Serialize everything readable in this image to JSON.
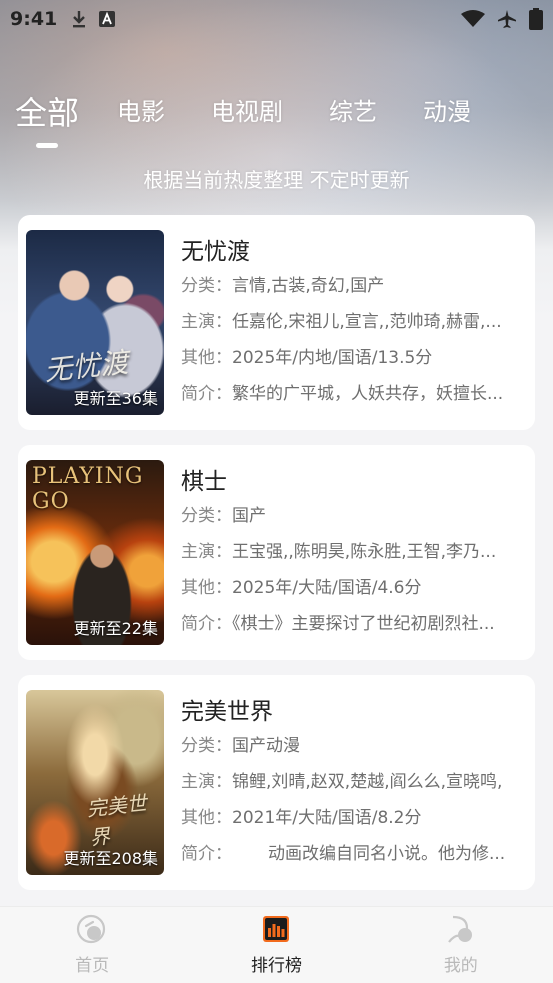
{
  "status_bar": {
    "time": "9:41",
    "icons": [
      "download-icon",
      "app-a-icon",
      "wifi-icon",
      "airplane-icon",
      "battery-icon"
    ]
  },
  "tabs": [
    {
      "label": "全部",
      "active": true
    },
    {
      "label": "电影",
      "active": false
    },
    {
      "label": "电视剧",
      "active": false
    },
    {
      "label": "综艺",
      "active": false
    },
    {
      "label": "动漫",
      "active": false
    }
  ],
  "subtitle": "根据当前热度整理 不定时更新",
  "cards": [
    {
      "title": "无忧渡",
      "badge": "更新至36集",
      "category_label": "分类：",
      "category": "言情,古装,奇幻,国产",
      "cast_label": "主演：",
      "cast": "任嘉伦,宋祖儿,宣言,,范帅琦,赫雷,...",
      "other_label": "其他：",
      "other": "2025年/内地/国语/13.5分",
      "intro_label": "简介：",
      "intro": "繁华的广平城，人妖共存，妖擅长...",
      "poster_colors": [
        "#2b3a5c",
        "#4f6a96",
        "#8a9fbf"
      ],
      "poster_art": "无忧渡"
    },
    {
      "title": "棋士",
      "badge": "更新至22集",
      "category_label": "分类：",
      "category": "国产",
      "cast_label": "主演：",
      "cast": "王宝强,,陈明昊,陈永胜,王智,李乃...",
      "other_label": "其他：",
      "other": "2025年/大陆/国语/4.6分",
      "intro_label": "简介：",
      "intro": "《棋士》主要探讨了世纪初剧烈社...",
      "poster_colors": [
        "#1c130c",
        "#8a3d12",
        "#f0a23a"
      ],
      "poster_art": "PLAYING GO"
    },
    {
      "title": "完美世界",
      "badge": "更新至208集",
      "category_label": "分类：",
      "category": "国产动漫",
      "cast_label": "主演：",
      "cast": "锦鲤,刘晴,赵双,楚越,阎么么,宣晓鸣,",
      "other_label": "其他：",
      "other": "2021年/大陆/国语/8.2分",
      "intro_label": "简介：",
      "intro": "动画改编自同名小说。他为修...",
      "poster_colors": [
        "#3a2a1a",
        "#a8773e",
        "#e6c98a"
      ],
      "poster_art": "完美世界"
    }
  ],
  "bottom_nav": [
    {
      "label": "首页",
      "icon": "home-icon",
      "active": false
    },
    {
      "label": "排行榜",
      "icon": "ranking-icon",
      "active": true
    },
    {
      "label": "我的",
      "icon": "profile-icon",
      "active": false
    }
  ],
  "colors": {
    "accent": "#f26b1d",
    "card_bg": "#ffffff",
    "text_primary": "#222222",
    "text_secondary": "#6f6f6f"
  }
}
